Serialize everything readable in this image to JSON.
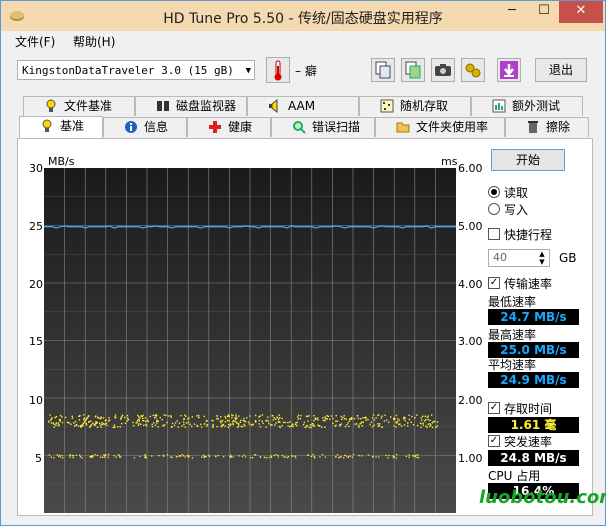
{
  "window": {
    "title": "HD Tune Pro 5.50 - 传统/固态硬盘实用程序",
    "minimize_label": "─",
    "maximize_label": "☐",
    "close_label": "✕"
  },
  "menu": {
    "file": "文件(F)",
    "help": "帮助(H)"
  },
  "toolbar": {
    "drive": "KingstonDataTraveler 3.0 (15 gB)",
    "temperature": "– 癖",
    "exit_label": "退出"
  },
  "tabs_top": [
    {
      "label": "文件基准",
      "icon": "file-bench-icon"
    },
    {
      "label": "磁盘监视器",
      "icon": "disk-monitor-icon"
    },
    {
      "label": "AAM",
      "icon": "speaker-icon"
    },
    {
      "label": "随机存取",
      "icon": "random-access-icon"
    },
    {
      "label": "额外测试",
      "icon": "extra-tests-icon"
    }
  ],
  "tabs_bottom": [
    {
      "label": "基准",
      "icon": "benchmark-icon"
    },
    {
      "label": "信息",
      "icon": "info-icon"
    },
    {
      "label": "健康",
      "icon": "health-cross-icon"
    },
    {
      "label": "错误扫描",
      "icon": "error-scan-icon"
    },
    {
      "label": "文件夹使用率",
      "icon": "folder-icon"
    },
    {
      "label": "擦除",
      "icon": "erase-icon"
    }
  ],
  "chart": {
    "left_unit": "MB/s",
    "right_unit": "ms",
    "left_ticks": [
      "30",
      "25",
      "20",
      "15",
      "10",
      "5"
    ],
    "right_ticks": [
      "6.00",
      "5.00",
      "4.00",
      "3.00",
      "2.00",
      "1.00"
    ]
  },
  "chart_data": {
    "type": "line",
    "series": [
      {
        "name": "传输速率",
        "color": "#3fa6e8",
        "axis": "MB/s",
        "values": [
          24.9,
          24.9,
          24.9,
          24.9,
          24.9,
          24.9,
          24.9,
          24.9,
          24.9,
          24.9
        ]
      },
      {
        "name": "存取时间",
        "color": "#ffee33",
        "axis": "ms",
        "level_approx": 1.61
      }
    ],
    "ylim_left": [
      0,
      30
    ],
    "ylim_right": [
      0,
      6
    ],
    "grid": true
  },
  "controls": {
    "start_label": "开始",
    "read_label": "读取",
    "write_label": "写入",
    "quick_label": "快捷行程",
    "gb_value": "40",
    "gb_unit": "GB",
    "transfer_label": "传输速率",
    "min_label": "最低速率",
    "min_value": "24.7 MB/s",
    "max_label": "最高速率",
    "max_value": "25.0 MB/s",
    "avg_label": "平均速率",
    "avg_value": "24.9 MB/s",
    "access_label": "存取时间",
    "access_value": "1.61 毫",
    "burst_label": "突发速率",
    "burst_value": "24.8 MB/s",
    "cpu_label": "CPU 占用",
    "cpu_value": "16.4%"
  },
  "watermark": "luobotou.com"
}
